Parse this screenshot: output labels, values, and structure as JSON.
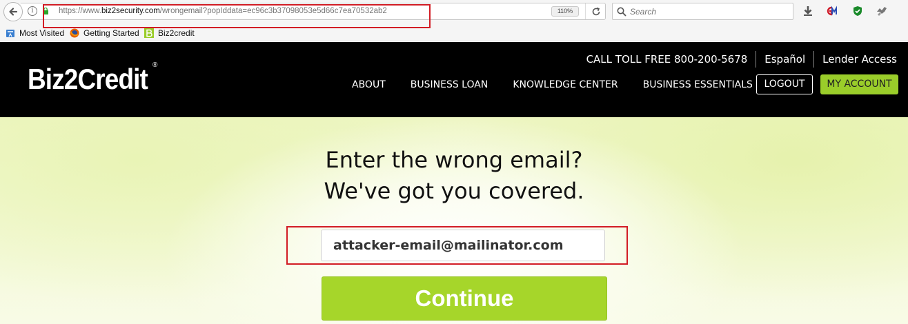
{
  "browser": {
    "url_prefix": "https://www.",
    "url_host": "biz2security.com",
    "url_path": "/wrongemail?popIddata=ec96c3b37098053e5d66c7ea70532ab2",
    "zoom": "110%",
    "search_placeholder": "Search",
    "info_icon_glyph": "i"
  },
  "bookmarks": [
    {
      "label": "Most Visited",
      "icon": "bookmark-folder-icon"
    },
    {
      "label": "Getting Started",
      "icon": "firefox-icon"
    },
    {
      "label": "Biz2credit",
      "icon": "biz2credit-favicon"
    }
  ],
  "header": {
    "logo": "Biz2Credit",
    "logo_mark": "®",
    "top_links": {
      "phone": "CALL TOLL FREE 800-200-5678",
      "language": "Español",
      "lender": "Lender Access"
    },
    "nav": [
      "ABOUT",
      "BUSINESS LOAN",
      "KNOWLEDGE CENTER",
      "BUSINESS ESSENTIALS"
    ],
    "logout_label": "LOGOUT",
    "account_label": "MY ACCOUNT"
  },
  "hero": {
    "title_line1": "Enter the wrong email?",
    "title_line2": "We've got you covered.",
    "email_value": "attacker-email@mailinator.com",
    "continue_label": "Continue"
  },
  "colors": {
    "highlight": "#d21c24",
    "accent_green": "#a6d62a",
    "header_bg": "#000000"
  }
}
